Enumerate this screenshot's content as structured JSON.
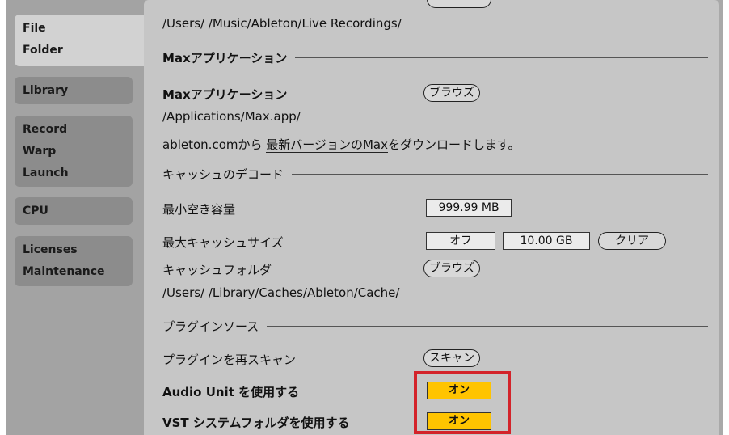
{
  "sidebar": {
    "groups": [
      {
        "items": [
          "File",
          "Folder"
        ]
      },
      {
        "items": [
          "Library"
        ]
      },
      {
        "items": [
          "Record",
          "Warp",
          "Launch"
        ]
      },
      {
        "items": [
          "CPU"
        ]
      },
      {
        "items": [
          "Licenses",
          "Maintenance"
        ]
      }
    ]
  },
  "recording": {
    "path": "/Users/   /Music/Ableton/Live Recordings/"
  },
  "max": {
    "section_title": "Maxアプリケーション",
    "label": "Maxアプリケーション",
    "browse": "ブラウズ",
    "path": "/Applications/Max.app/",
    "download_prefix": "ableton.comから",
    "download_link": "最新バージョンのMax",
    "download_suffix": "をダウンロードします。"
  },
  "cache": {
    "section_title": "キャッシュのデコード",
    "min_free_label": "最小空き容量",
    "min_free_value": "999.99 MB",
    "max_size_label": "最大キャッシュサイズ",
    "max_size_toggle": "オフ",
    "max_size_value": "10.00 GB",
    "clear": "クリア",
    "folder_label": "キャッシュフォルダ",
    "browse": "ブラウズ",
    "folder_path": "/Users/   /Library/Caches/Ableton/Cache/"
  },
  "plugins": {
    "section_title": "プラグインソース",
    "rescan_label": "プラグインを再スキャン",
    "rescan_button": "スキャン",
    "au_label": "Audio Unit を使用する",
    "au_value": "オン",
    "vst_label": "VST システムフォルダを使用する",
    "vst_value": "オン"
  },
  "colors": {
    "toggle_on": "#ffc400",
    "highlight": "#d3232a"
  }
}
